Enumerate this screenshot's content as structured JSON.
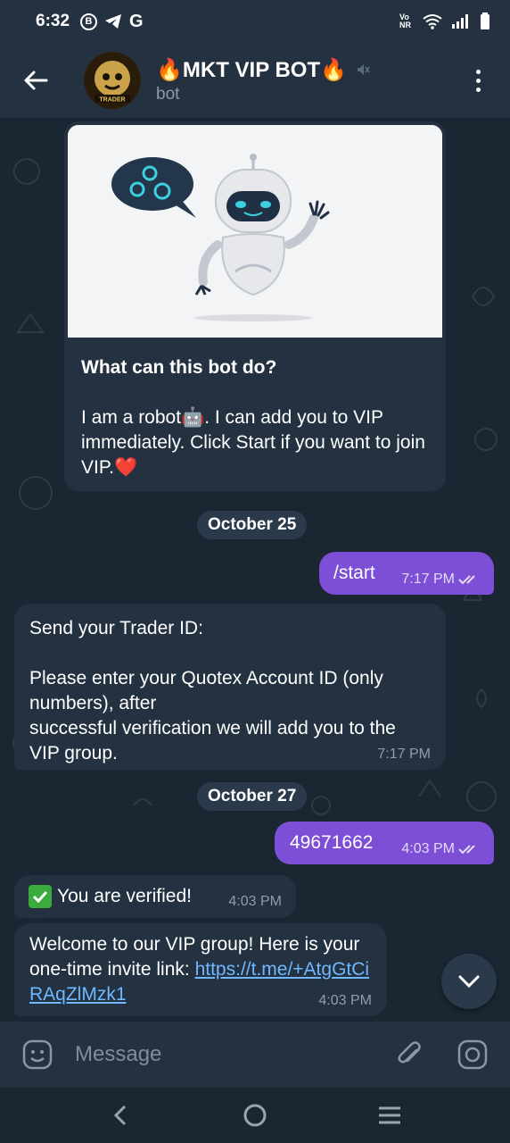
{
  "status_bar": {
    "time": "6:32",
    "net_label": "Vo NR"
  },
  "header": {
    "title": "🔥MKT VIP BOT🔥",
    "subtitle": "bot",
    "avatar_text": "TRADER"
  },
  "intro_card": {
    "heading": "What can this bot do?",
    "text": "I am a robot🤖. I can add you to VIP immediately. Click Start if you want to join VIP.❤️"
  },
  "messages": [
    {
      "type": "date",
      "text": "October 25"
    },
    {
      "type": "out",
      "text": "/start",
      "time": "7:17 PM"
    },
    {
      "type": "in",
      "line1": "Send your Trader ID:",
      "line2": "Please enter your Quotex Account ID (only numbers), after",
      "line3": "successful verification we will add you to the VIP group.",
      "time": "7:17 PM"
    },
    {
      "type": "date",
      "text": "October 27"
    },
    {
      "type": "out",
      "text": "49671662",
      "time": "4:03 PM"
    },
    {
      "type": "in",
      "text": "You are verified!",
      "time": "4:03 PM"
    },
    {
      "type": "in",
      "text": "Welcome to our VIP group! Here is your one-time invite link: ",
      "link": "https://t.me/+AtgGtCiRAqZlMzk1",
      "time": "4:03 PM"
    }
  ],
  "input": {
    "placeholder": "Message"
  },
  "colors": {
    "header_bg": "#243140",
    "chat_bg": "#1a2632",
    "bubble_out": "#7c4fd6",
    "bubble_in": "#233140",
    "link": "#6fb8ff"
  },
  "icons": [
    "back-arrow-icon",
    "muted-icon",
    "more-vert-icon",
    "emoji-icon",
    "attach-icon",
    "camera-icon",
    "chevron-down-icon",
    "nav-back-icon",
    "nav-home-icon",
    "nav-recents-icon",
    "double-check-icon",
    "check-mark-icon",
    "wifi-icon",
    "signal-icon",
    "battery-icon"
  ]
}
